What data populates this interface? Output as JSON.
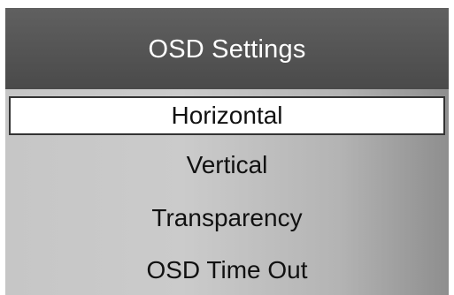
{
  "header": {
    "title": "OSD Settings"
  },
  "menu": {
    "items": [
      {
        "label": "Horizontal",
        "selected": true
      },
      {
        "label": "Vertical",
        "selected": false
      },
      {
        "label": "Transparency",
        "selected": false
      },
      {
        "label": "OSD Time Out",
        "selected": false
      }
    ]
  },
  "colors": {
    "header_bg": "#555555",
    "header_text": "#ffffff",
    "body_bg": "#c4c4c4",
    "selected_bg": "#ffffff",
    "item_text": "#111111"
  }
}
